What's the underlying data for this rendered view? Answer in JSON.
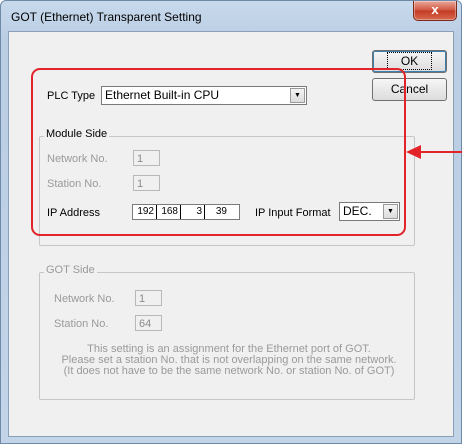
{
  "window": {
    "title": "GOT (Ethernet) Transparent Setting",
    "close_glyph": "x"
  },
  "buttons": {
    "ok_label": "OK",
    "cancel_label": "Cancel"
  },
  "plc_type": {
    "label": "PLC Type",
    "value": "Ethernet Built-in CPU"
  },
  "module_side": {
    "legend": "Module Side",
    "network_no_label": "Network No.",
    "network_no_value": "1",
    "station_no_label": "Station No.",
    "station_no_value": "1",
    "ip_address_label": "IP Address",
    "ip_octets": [
      "192",
      "168",
      "3",
      "39"
    ],
    "ip_input_format_label": "IP Input Format",
    "ip_input_format_value": "DEC."
  },
  "got_side": {
    "legend": "GOT Side",
    "network_no_label": "Network No.",
    "network_no_value": "1",
    "station_no_label": "Station No.",
    "station_no_value": "64",
    "note_lines": [
      "This setting is an assignment for the Ethernet port of GOT.",
      "Please set a station No. that is not overlapping on the same network.",
      "(It does not have to be the same network No. or station No. of GOT)"
    ]
  },
  "colors": {
    "annotation": "#e2232a"
  }
}
